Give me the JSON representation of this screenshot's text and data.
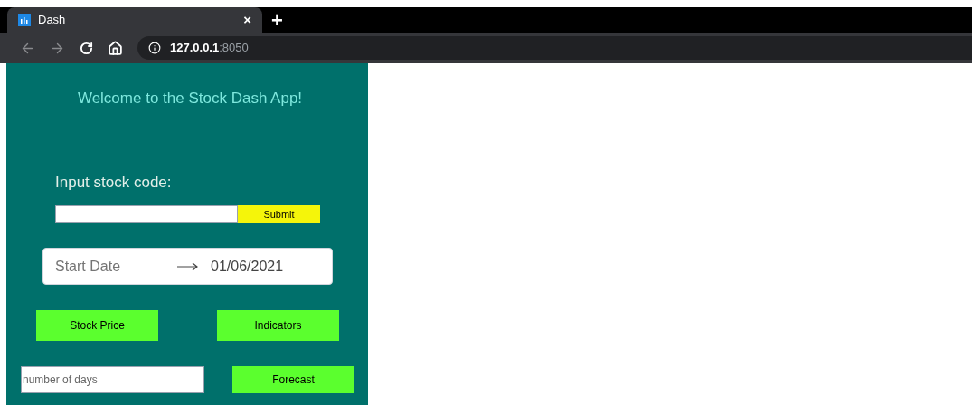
{
  "browser": {
    "tab": {
      "title": "Dash",
      "close": "×"
    },
    "new_tab": "+",
    "url": "**127.0.0.1**:8050"
  },
  "sidebar": {
    "heading": "Welcome to the Stock Dash App!",
    "stock_label": "Input stock code:",
    "submit": "Submit",
    "date_range": {
      "start_placeholder": "Start Date",
      "end_value": "01/06/2021"
    },
    "buttons": [
      "Stock Price",
      "Indicators"
    ],
    "days_placeholder": "number of days",
    "forecast": "Forecast"
  }
}
